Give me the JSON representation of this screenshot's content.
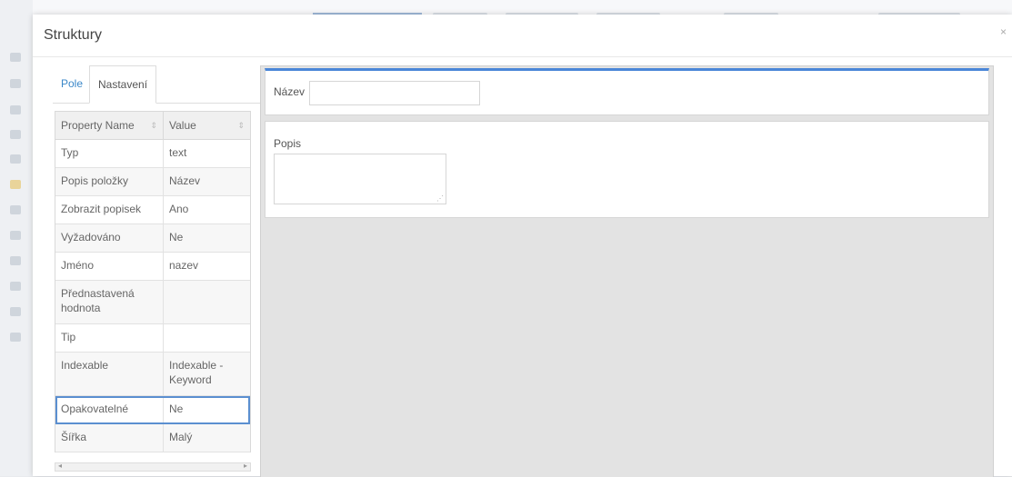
{
  "modal": {
    "title": "Struktury",
    "close": "×"
  },
  "tabs": [
    {
      "label": "Pole"
    },
    {
      "label": "Nastavení"
    }
  ],
  "grid": {
    "headers": {
      "name": "Property Name",
      "value": "Value"
    },
    "sort_icon": "⇕",
    "rows": [
      {
        "name": "Typ",
        "value": "text"
      },
      {
        "name": "Popis položky",
        "value": "Název"
      },
      {
        "name": "Zobrazit popisek",
        "value": "Ano"
      },
      {
        "name": "Vyžadováno",
        "value": "Ne"
      },
      {
        "name": "Jméno",
        "value": "nazev"
      },
      {
        "name": "Přednastavená hodnota",
        "value": ""
      },
      {
        "name": "Tip",
        "value": ""
      },
      {
        "name": "Indexable",
        "value": "Indexable - Keyword"
      },
      {
        "name": "Opakovatelné",
        "value": "Ne"
      },
      {
        "name": "Šířka",
        "value": "Malý"
      }
    ],
    "scroll_left": "◂",
    "scroll_right": "▸"
  },
  "canvas": {
    "field1_label": "Název",
    "field2_label": "Popis"
  },
  "colors": {
    "accent": "#4a86d8",
    "tab_active": "#3a87c8"
  }
}
